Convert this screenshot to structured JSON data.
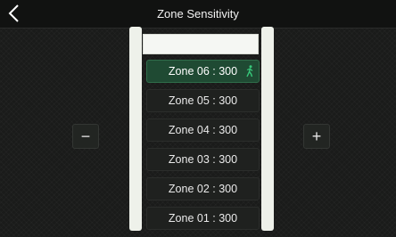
{
  "header": {
    "title": "Zone Sensitivity",
    "back_icon": "chevron-left-icon"
  },
  "zones": [
    {
      "label": "Zone 06 : 300",
      "selected": true,
      "icon": "walking-person-icon"
    },
    {
      "label": "Zone 05 : 300",
      "selected": false
    },
    {
      "label": "Zone 04 : 300",
      "selected": false
    },
    {
      "label": "Zone 03 : 300",
      "selected": false
    },
    {
      "label": "Zone 02 : 300",
      "selected": false
    },
    {
      "label": "Zone 01 : 300",
      "selected": false
    }
  ],
  "controls": {
    "decrease_label": "−",
    "increase_label": "+"
  },
  "colors": {
    "background": "#1a1b1a",
    "selected": "#1f4a33",
    "accent": "#37c87a"
  }
}
